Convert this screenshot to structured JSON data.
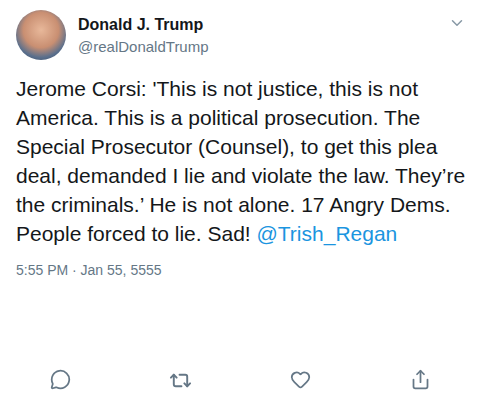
{
  "author": {
    "name": "Donald J. Trump",
    "handle": "@realDonaldTrump"
  },
  "tweet": {
    "text": "Jerome Corsi: 'This is not justice, this is not America. This is a political prosecution. The Special Prosecutor (Counsel), to get this plea deal, demanded I lie and violate the law. They’re the criminals.’ He is not alone. 17 Angry Dems. People forced to lie. Sad!",
    "mention": "@Trish_Regan"
  },
  "timestamp": "5:55 PM · Jan 55, 5555"
}
